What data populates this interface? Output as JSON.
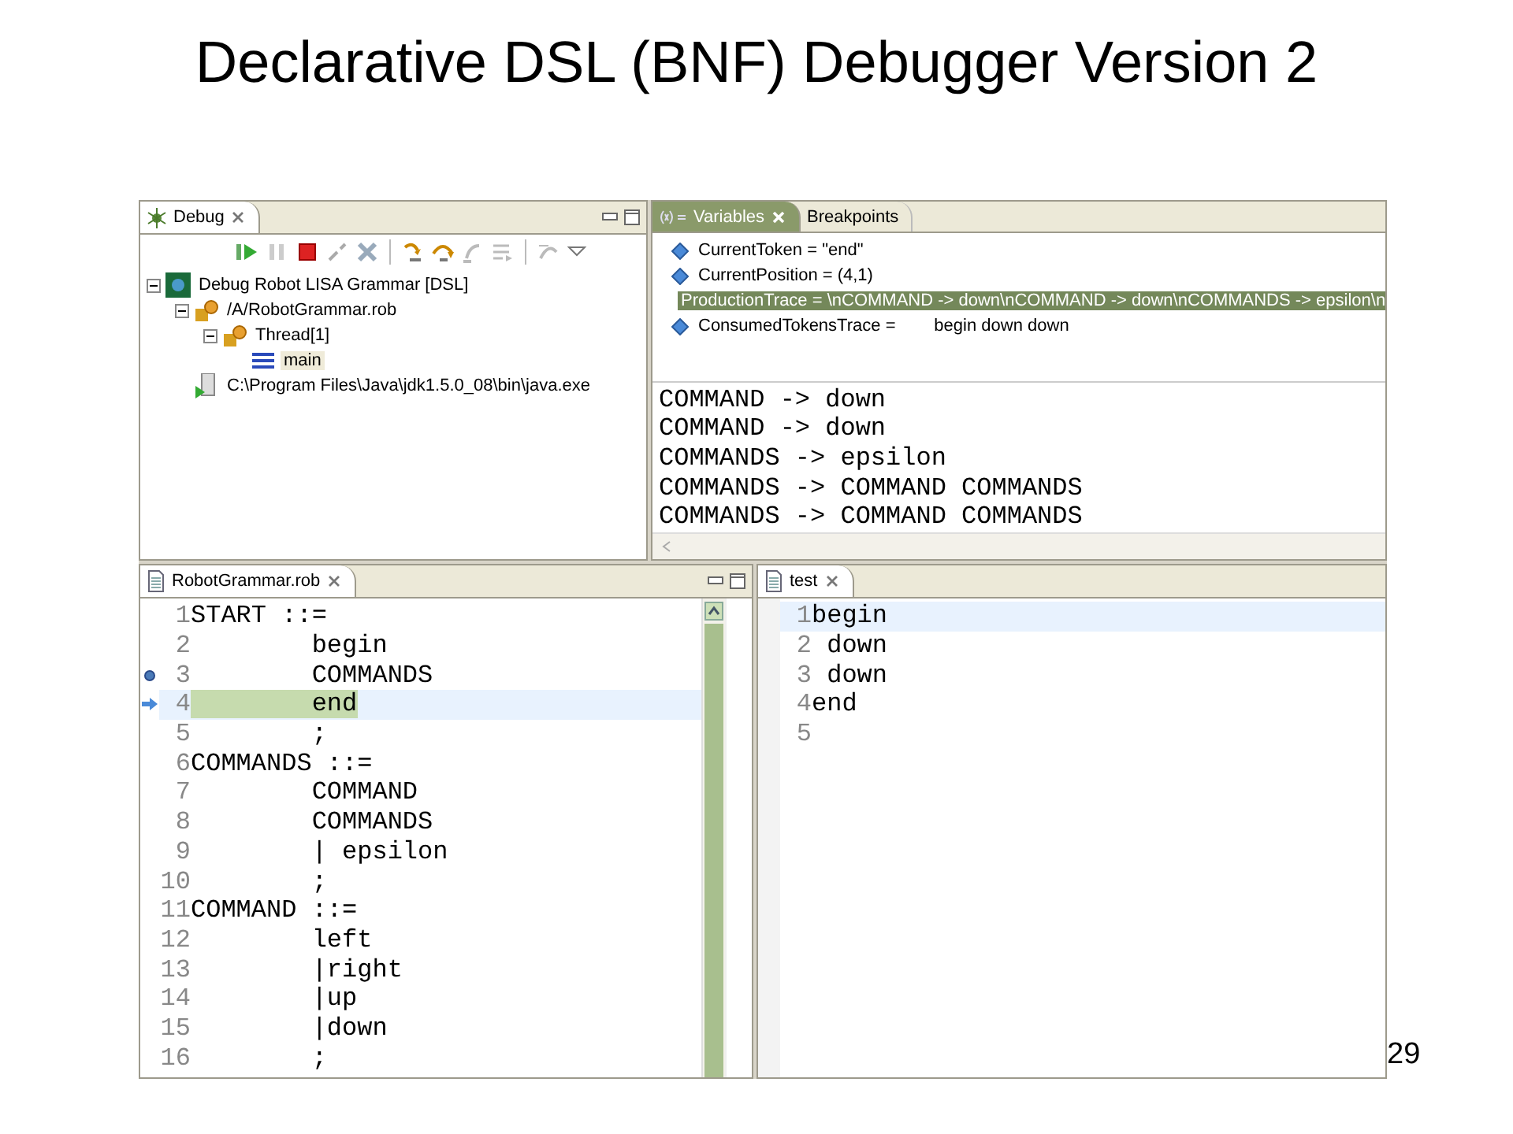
{
  "slide": {
    "title": "Declarative DSL (BNF) Debugger Version 2",
    "page_number": "29"
  },
  "debug_view": {
    "tab": "Debug",
    "tree": [
      {
        "label": "Debug Robot LISA Grammar [DSL]",
        "kind": "launch",
        "expanded": true,
        "selected": false,
        "children": [
          {
            "label": "/A/RobotGrammar.rob",
            "kind": "target",
            "expanded": true,
            "selected": false,
            "children": [
              {
                "label": "Thread[1]",
                "kind": "thread",
                "expanded": true,
                "selected": false,
                "children": [
                  {
                    "label": "main",
                    "kind": "frame",
                    "selected": true
                  }
                ]
              }
            ]
          },
          {
            "label": "C:\\Program Files\\Java\\jdk1.5.0_08\\bin\\java.exe",
            "kind": "process",
            "selected": false
          }
        ]
      }
    ]
  },
  "variables_view": {
    "tabs": [
      {
        "label": "Variables",
        "selected": true
      },
      {
        "label": "Breakpoints",
        "selected": false
      }
    ],
    "variables": [
      {
        "text": "CurrentToken = \"end\"",
        "selected": false
      },
      {
        "text": "CurrentPosition = (4,1)",
        "selected": false
      },
      {
        "text": "ProductionTrace = \\nCOMMAND -> down\\nCOMMAND -> down\\nCOMMANDS -> epsilon\\n",
        "selected": true
      },
      {
        "text": "ConsumedTokensTrace =        begin down down",
        "selected": false
      }
    ],
    "detail_lines": [
      "COMMAND -> down",
      "COMMAND -> down",
      "COMMANDS -> epsilon",
      "COMMANDS -> COMMAND COMMANDS",
      "COMMANDS -> COMMAND COMMANDS"
    ]
  },
  "grammar_editor": {
    "tab": "RobotGrammar.rob",
    "lines": [
      {
        "number": "1",
        "text": "START ::=",
        "breakpoint": false,
        "current": false,
        "cursor": false
      },
      {
        "number": "2",
        "text": "        begin",
        "breakpoint": false,
        "current": false,
        "cursor": false
      },
      {
        "number": "3",
        "text": "        COMMANDS",
        "breakpoint": true,
        "current": false,
        "cursor": false
      },
      {
        "number": "4",
        "text": "        end",
        "breakpoint": false,
        "current": true,
        "cursor": true
      },
      {
        "number": "5",
        "text": "        ;",
        "breakpoint": false,
        "current": false,
        "cursor": false
      },
      {
        "number": "6",
        "text": "COMMANDS ::=",
        "breakpoint": false,
        "current": false,
        "cursor": false
      },
      {
        "number": "7",
        "text": "        COMMAND",
        "breakpoint": false,
        "current": false,
        "cursor": false
      },
      {
        "number": "8",
        "text": "        COMMANDS",
        "breakpoint": false,
        "current": false,
        "cursor": false
      },
      {
        "number": "9",
        "text": "        | epsilon",
        "breakpoint": false,
        "current": false,
        "cursor": false
      },
      {
        "number": "10",
        "text": "        ;",
        "breakpoint": false,
        "current": false,
        "cursor": false
      },
      {
        "number": "11",
        "text": "COMMAND ::=",
        "breakpoint": false,
        "current": false,
        "cursor": false
      },
      {
        "number": "12",
        "text": "        left",
        "breakpoint": false,
        "current": false,
        "cursor": false
      },
      {
        "number": "13",
        "text": "        |right",
        "breakpoint": false,
        "current": false,
        "cursor": false
      },
      {
        "number": "14",
        "text": "        |up",
        "breakpoint": false,
        "current": false,
        "cursor": false
      },
      {
        "number": "15",
        "text": "        |down",
        "breakpoint": false,
        "current": false,
        "cursor": false
      },
      {
        "number": "16",
        "text": "        ;",
        "breakpoint": false,
        "current": false,
        "cursor": false
      }
    ]
  },
  "test_editor": {
    "tab": "test",
    "lines": [
      {
        "number": "1",
        "text": "begin",
        "cursor": true
      },
      {
        "number": "2",
        "text": " down",
        "cursor": false
      },
      {
        "number": "3",
        "text": " down",
        "cursor": false
      },
      {
        "number": "4",
        "text": "end",
        "cursor": false
      },
      {
        "number": "5",
        "cursor": false
      }
    ]
  }
}
